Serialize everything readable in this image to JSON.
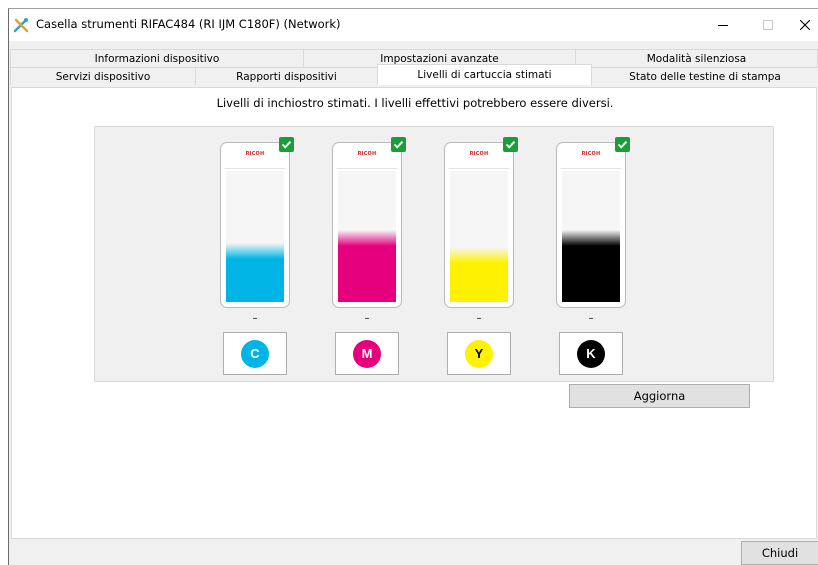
{
  "window": {
    "title": "Casella strumenti RIFAC484 (RI IJM C180F) (Network)",
    "icon": "tools-icon"
  },
  "tabs": {
    "row1": [
      {
        "label": "Informazioni dispositivo"
      },
      {
        "label": "Impostazioni avanzate"
      },
      {
        "label": "Modalità silenziosa"
      }
    ],
    "row2": [
      {
        "label": "Servizi dispositivo"
      },
      {
        "label": "Rapporti dispositivi"
      },
      {
        "label": "Livelli di cartuccia stimati",
        "active": true
      },
      {
        "label": "Stato delle testine di stampa"
      }
    ]
  },
  "panel": {
    "notice": "Livelli di inchiostro stimati. I livelli effettivi potrebbero essere diversi."
  },
  "cartridges": [
    {
      "name": "Cyan",
      "letter": "C",
      "brand": "RICOH",
      "level_label": "–",
      "level_percent": 45,
      "color": "#00b5e6",
      "status": "ok"
    },
    {
      "name": "Magenta",
      "letter": "M",
      "brand": "RICOH",
      "level_label": "–",
      "level_percent": 55,
      "color": "#e6007e",
      "status": "ok"
    },
    {
      "name": "Yellow",
      "letter": "Y",
      "brand": "RICOH",
      "level_label": "–",
      "level_percent": 42,
      "color": "#fff200",
      "status": "ok"
    },
    {
      "name": "Black",
      "letter": "K",
      "brand": "RICOH",
      "level_label": "–",
      "level_percent": 55,
      "color": "#000000",
      "status": "ok"
    }
  ],
  "buttons": {
    "refresh": "Aggiorna",
    "close": "Chiudi"
  }
}
